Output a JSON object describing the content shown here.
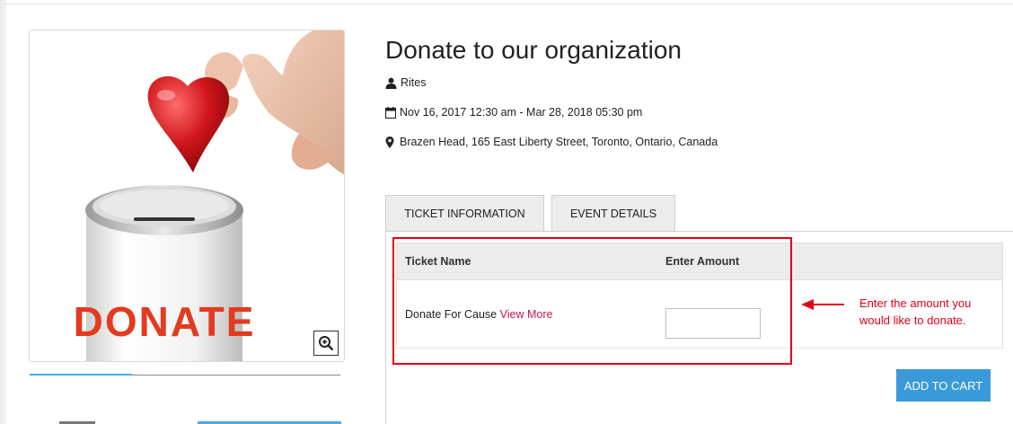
{
  "event": {
    "title": "Donate to our organization",
    "organizer": "Rites",
    "datetime": "Nov 16, 2017 12:30 am - Mar 28, 2018 05:30 pm",
    "location": "Brazen Head, 165 East Liberty Street, Toronto, Ontario, Canada"
  },
  "image": {
    "label": "DONATE",
    "icons": {
      "zoom": "zoom-in-icon"
    }
  },
  "tabs": [
    {
      "label": "TICKET INFORMATION",
      "active": true
    },
    {
      "label": "EVENT DETAILS",
      "active": false
    }
  ],
  "table": {
    "headers": [
      "Ticket Name",
      "Enter Amount"
    ],
    "rows": [
      {
        "name": "Donate For Cause",
        "link": "View More",
        "amount": ""
      }
    ]
  },
  "annotation": {
    "note": "Enter the amount you would like to donate."
  },
  "cart": {
    "button_label": "ADD TO CART"
  },
  "colors": {
    "accent": "#3a9ad9",
    "link": "#c2185b",
    "annotation": "#e0001a"
  }
}
